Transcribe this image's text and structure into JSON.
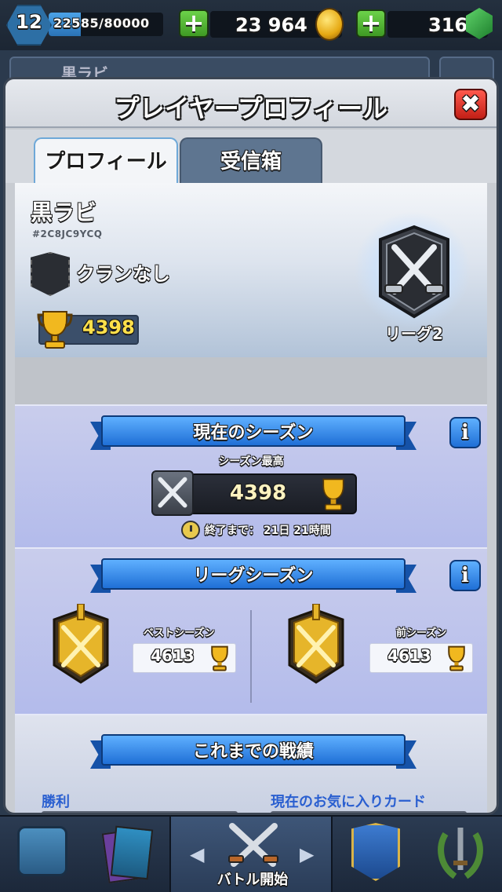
{
  "top_bar": {
    "level": "12",
    "xp_text": "22585/80000",
    "xp_progress": 0.2823,
    "gold": "23 964",
    "gems": "316"
  },
  "background": {
    "player_name": "黒ラビ"
  },
  "modal": {
    "title": "プレイヤープロフィール",
    "close_label": "✖",
    "tabs": [
      {
        "label": "プロフィール",
        "active": true
      },
      {
        "label": "受信箱",
        "active": false
      }
    ]
  },
  "profile": {
    "name": "黒ラビ",
    "tag": "#2C8JC9YCQ",
    "clan": "クランなし",
    "trophies": "4398",
    "league": "リーグ2"
  },
  "current_season": {
    "header": "現在のシーズン",
    "info_label": "i",
    "best_label": "シーズン最高",
    "best_value": "4398",
    "ends_label": "終了まで： 21日 21時間"
  },
  "league_season": {
    "header": "リーグシーズン",
    "info_label": "i",
    "best_label": "ベストシーズン",
    "best_value": "4613",
    "prev_label": "前シーズン",
    "prev_value": "4613"
  },
  "records": {
    "header": "これまでの戦績",
    "wins_label": "勝利",
    "fav_card_label": "現在のお気に入りカード"
  },
  "bottom_nav": {
    "battle_label": "バトル開始",
    "arrow_left": "◀",
    "arrow_right": "▶"
  },
  "colors": {
    "accent_blue": "#1f6fd6",
    "close_red": "#c21f16",
    "trophy_gold": "#ffe04a",
    "plus_green": "#3f9a24"
  }
}
